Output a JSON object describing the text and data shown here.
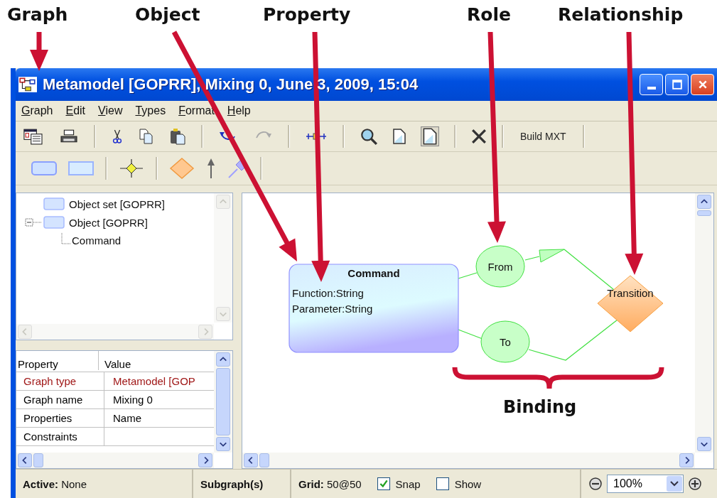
{
  "annotations": [
    {
      "label": "Graph"
    },
    {
      "label": "Object"
    },
    {
      "label": "Property"
    },
    {
      "label": "Role"
    },
    {
      "label": "Relationship"
    }
  ],
  "binding_label": "Binding",
  "window": {
    "title": "Metamodel [GOPRR], Mixing 0, June 3, 2009, 15:04"
  },
  "menu": [
    {
      "label": "Graph"
    },
    {
      "label": "Edit"
    },
    {
      "label": "View"
    },
    {
      "label": "Types"
    },
    {
      "label": "Format"
    },
    {
      "label": "Help"
    }
  ],
  "toolbar": {
    "build_button": "Build MXT"
  },
  "tree": [
    {
      "label": "Object set [GOPRR]"
    },
    {
      "label": "Object [GOPRR]",
      "expanded": true,
      "children": [
        {
          "label": "Command"
        }
      ]
    }
  ],
  "properties": {
    "columns": [
      "Property",
      "Value"
    ],
    "rows": [
      {
        "property": "Graph type",
        "value": "Metamodel [GOP",
        "highlighted": true
      },
      {
        "property": "Graph name",
        "value": "Mixing 0",
        "highlighted": false
      },
      {
        "property": "Properties",
        "value": "Name",
        "highlighted": false
      },
      {
        "property": "Constraints",
        "value": "",
        "highlighted": false
      }
    ]
  },
  "diagram": {
    "object": {
      "name": "Command",
      "properties": [
        "Function:String",
        "Parameter:String"
      ]
    },
    "roles": [
      {
        "label": "From"
      },
      {
        "label": "To"
      }
    ],
    "relationship": {
      "label": "Transition"
    }
  },
  "status_bar": {
    "active_label": "Active:",
    "active_value": "None",
    "subgraphs": "Subgraph(s)",
    "grid_label": "Grid:",
    "grid_value": "50@50",
    "snap": {
      "label": "Snap",
      "checked": true
    },
    "show": {
      "label": "Show",
      "checked": false
    },
    "zoom": "100%"
  }
}
